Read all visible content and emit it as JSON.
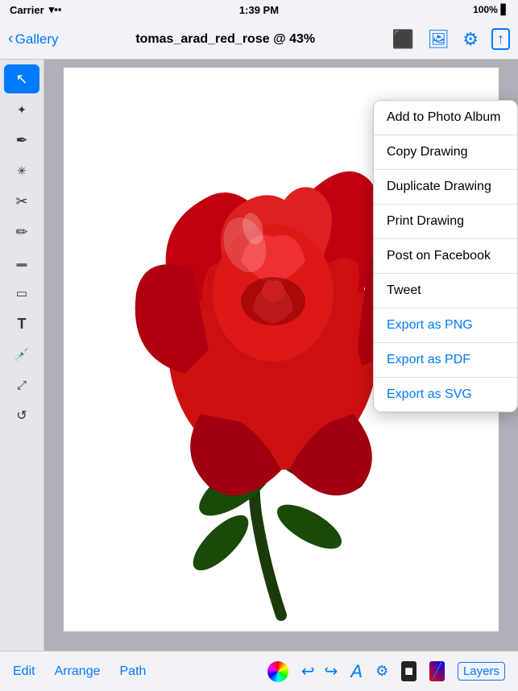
{
  "status": {
    "carrier": "Carrier",
    "wifi_icon": "📶",
    "time": "1:39 PM",
    "battery": "100%"
  },
  "nav": {
    "back_label": "Gallery",
    "title": "tomas_arad_red_rose @ 43%"
  },
  "nav_icons": {
    "frame": "⬜",
    "photo": "🖼",
    "gear": "⚙",
    "share": "↑"
  },
  "tools": [
    {
      "name": "select",
      "icon": "↖",
      "active": true
    },
    {
      "name": "node-select",
      "icon": "✦"
    },
    {
      "name": "pen",
      "icon": "✒"
    },
    {
      "name": "node-edit",
      "icon": "✳"
    },
    {
      "name": "scissors",
      "icon": "✂"
    },
    {
      "name": "pencil",
      "icon": "✏"
    },
    {
      "name": "eraser",
      "icon": "⬜"
    },
    {
      "name": "rectangle",
      "icon": "▭"
    },
    {
      "name": "text",
      "icon": "T"
    },
    {
      "name": "eyedropper",
      "icon": "💉"
    },
    {
      "name": "zoom",
      "icon": "⤢"
    },
    {
      "name": "history",
      "icon": "↺"
    }
  ],
  "menu": {
    "items": [
      {
        "label": "Add to Photo Album",
        "type": "normal"
      },
      {
        "label": "Copy Drawing",
        "type": "normal"
      },
      {
        "label": "Duplicate Drawing",
        "type": "normal"
      },
      {
        "label": "Print Drawing",
        "type": "normal"
      },
      {
        "label": "Post on Facebook",
        "type": "normal"
      },
      {
        "label": "Tweet",
        "type": "normal"
      },
      {
        "label": "Export as PNG",
        "type": "export"
      },
      {
        "label": "Export as PDF",
        "type": "export"
      },
      {
        "label": "Export as SVG",
        "type": "export"
      }
    ]
  },
  "bottom": {
    "edit_label": "Edit",
    "arrange_label": "Arrange",
    "path_label": "Path",
    "layers_label": "Layers"
  }
}
